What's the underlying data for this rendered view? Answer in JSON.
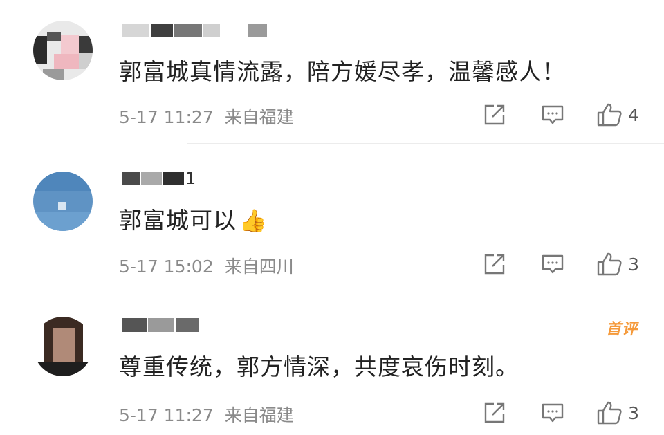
{
  "comments": [
    {
      "username": "",
      "text": "郭富城真情流露，陪方媛尽孝，温馨感人！",
      "time": "5-17 11:27",
      "location": "来自福建",
      "likes": "4"
    },
    {
      "username": "1",
      "text": "郭富城可以",
      "emoji": "👍",
      "time": "5-17 15:02",
      "location": "来自四川",
      "likes": "3"
    },
    {
      "username": "",
      "badge": "首评",
      "text": "尊重传统，郭方情深，共度哀伤时刻。",
      "time": "5-17 11:27",
      "location": "来自福建",
      "likes": "3"
    }
  ],
  "icons": {
    "share": "share-icon",
    "reply": "comment-icon",
    "like": "thumbs-up-icon"
  },
  "colors": {
    "text": "#222222",
    "meta": "#8a8a8a",
    "badge": "#f59a3b",
    "icon": "#777777"
  }
}
